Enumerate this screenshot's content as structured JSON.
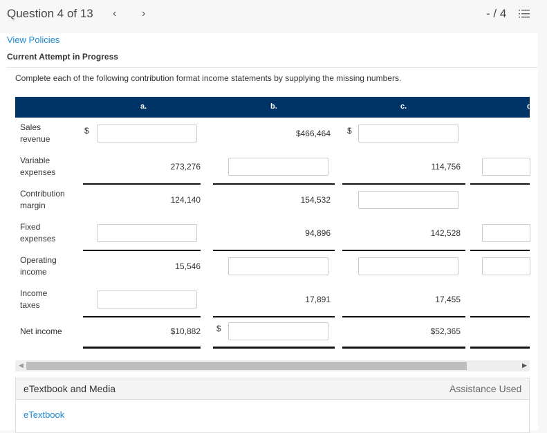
{
  "header": {
    "question": "Question 4 of 13",
    "prev_icon": "chevron-left-icon",
    "next_icon": "chevron-right-icon",
    "score": "- / 4",
    "list_icon": "numbered-list-icon"
  },
  "links": {
    "view_policies": "View Policies"
  },
  "status": "Current Attempt in Progress",
  "instructions": "Complete each of the following contribution format income statements by supplying the missing numbers.",
  "table": {
    "columns": [
      "a.",
      "b.",
      "c."
    ],
    "rows": [
      {
        "label": "Sales\nrevenue",
        "cells": [
          {
            "input": true,
            "dollar": true
          },
          {
            "value": "$466,464"
          },
          {
            "input": true,
            "dollar": true
          },
          {
            "value": ""
          }
        ]
      },
      {
        "label": "Variable\nexpenses",
        "cells": [
          {
            "value": "273,276"
          },
          {
            "input": true
          },
          {
            "value": "114,756"
          },
          {
            "input": true
          }
        ]
      },
      {
        "label": "Contribution\nmargin",
        "cells": [
          {
            "value": "124,140"
          },
          {
            "value": "154,532"
          },
          {
            "input": true
          },
          {
            "value": ""
          }
        ]
      },
      {
        "label": "Fixed\nexpenses",
        "cells": [
          {
            "input": true
          },
          {
            "value": "94,896"
          },
          {
            "value": "142,528"
          },
          {
            "input": true
          }
        ]
      },
      {
        "label": "Operating\nincome",
        "cells": [
          {
            "value": "15,546"
          },
          {
            "input": true
          },
          {
            "input": true
          },
          {
            "input": true
          }
        ]
      },
      {
        "label": "Income\ntaxes",
        "cells": [
          {
            "input": true
          },
          {
            "value": "17,891"
          },
          {
            "value": "17,455"
          },
          {
            "value": ""
          }
        ]
      },
      {
        "label": "Net income",
        "cells": [
          {
            "value": "$10,882"
          },
          {
            "input": true,
            "dollar": true
          },
          {
            "value": "$52,365"
          },
          {
            "value": ""
          }
        ]
      }
    ]
  },
  "panel": {
    "title": "eTextbook and Media",
    "assistance": "Assistance Used",
    "etextbook": "eTextbook"
  },
  "colors": {
    "header_bg": "#003366",
    "link": "#1a8ad4"
  }
}
